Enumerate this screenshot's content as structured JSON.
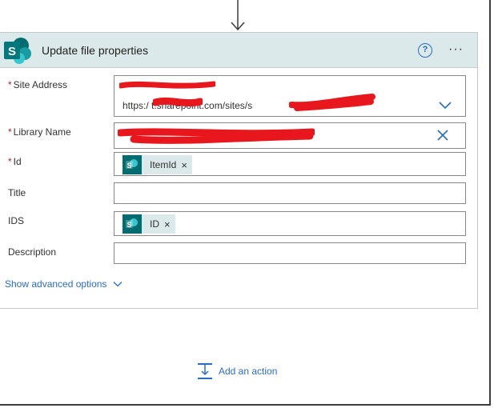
{
  "icons": {
    "flow_arrow": "arrow-down-icon",
    "sharepoint": "sharepoint-icon",
    "help": "help-icon",
    "more": "more-icon",
    "dropdown": "chevron-down-icon",
    "clear": "close-icon",
    "add_action": "add-action-icon"
  },
  "colors": {
    "header_bg": "#dbe9ea",
    "sharepoint": "#036c70",
    "link": "#2b6cc4",
    "required": "#a4262c",
    "redaction": "#e8171d"
  },
  "card": {
    "title": "Update file properties",
    "help_label": "?",
    "more_label": "···"
  },
  "fields": {
    "site_address": {
      "required_mark": "*",
      "label": "Site Address",
      "value_line1": "",
      "value_line2": "https:/                        t.sharepoint.com/sites/s"
    },
    "library_name": {
      "required_mark": "*",
      "label": "Library Name",
      "value": ""
    },
    "id": {
      "required_mark": "*",
      "label": "Id",
      "token": "ItemId",
      "token_close": "×"
    },
    "title": {
      "label": "Title",
      "value": ""
    },
    "ids": {
      "label": "IDS",
      "token": "ID",
      "token_close": "×"
    },
    "description": {
      "label": "Description",
      "value": ""
    }
  },
  "advanced": {
    "label": "Show advanced options"
  },
  "add_action": {
    "label": "Add an action"
  }
}
